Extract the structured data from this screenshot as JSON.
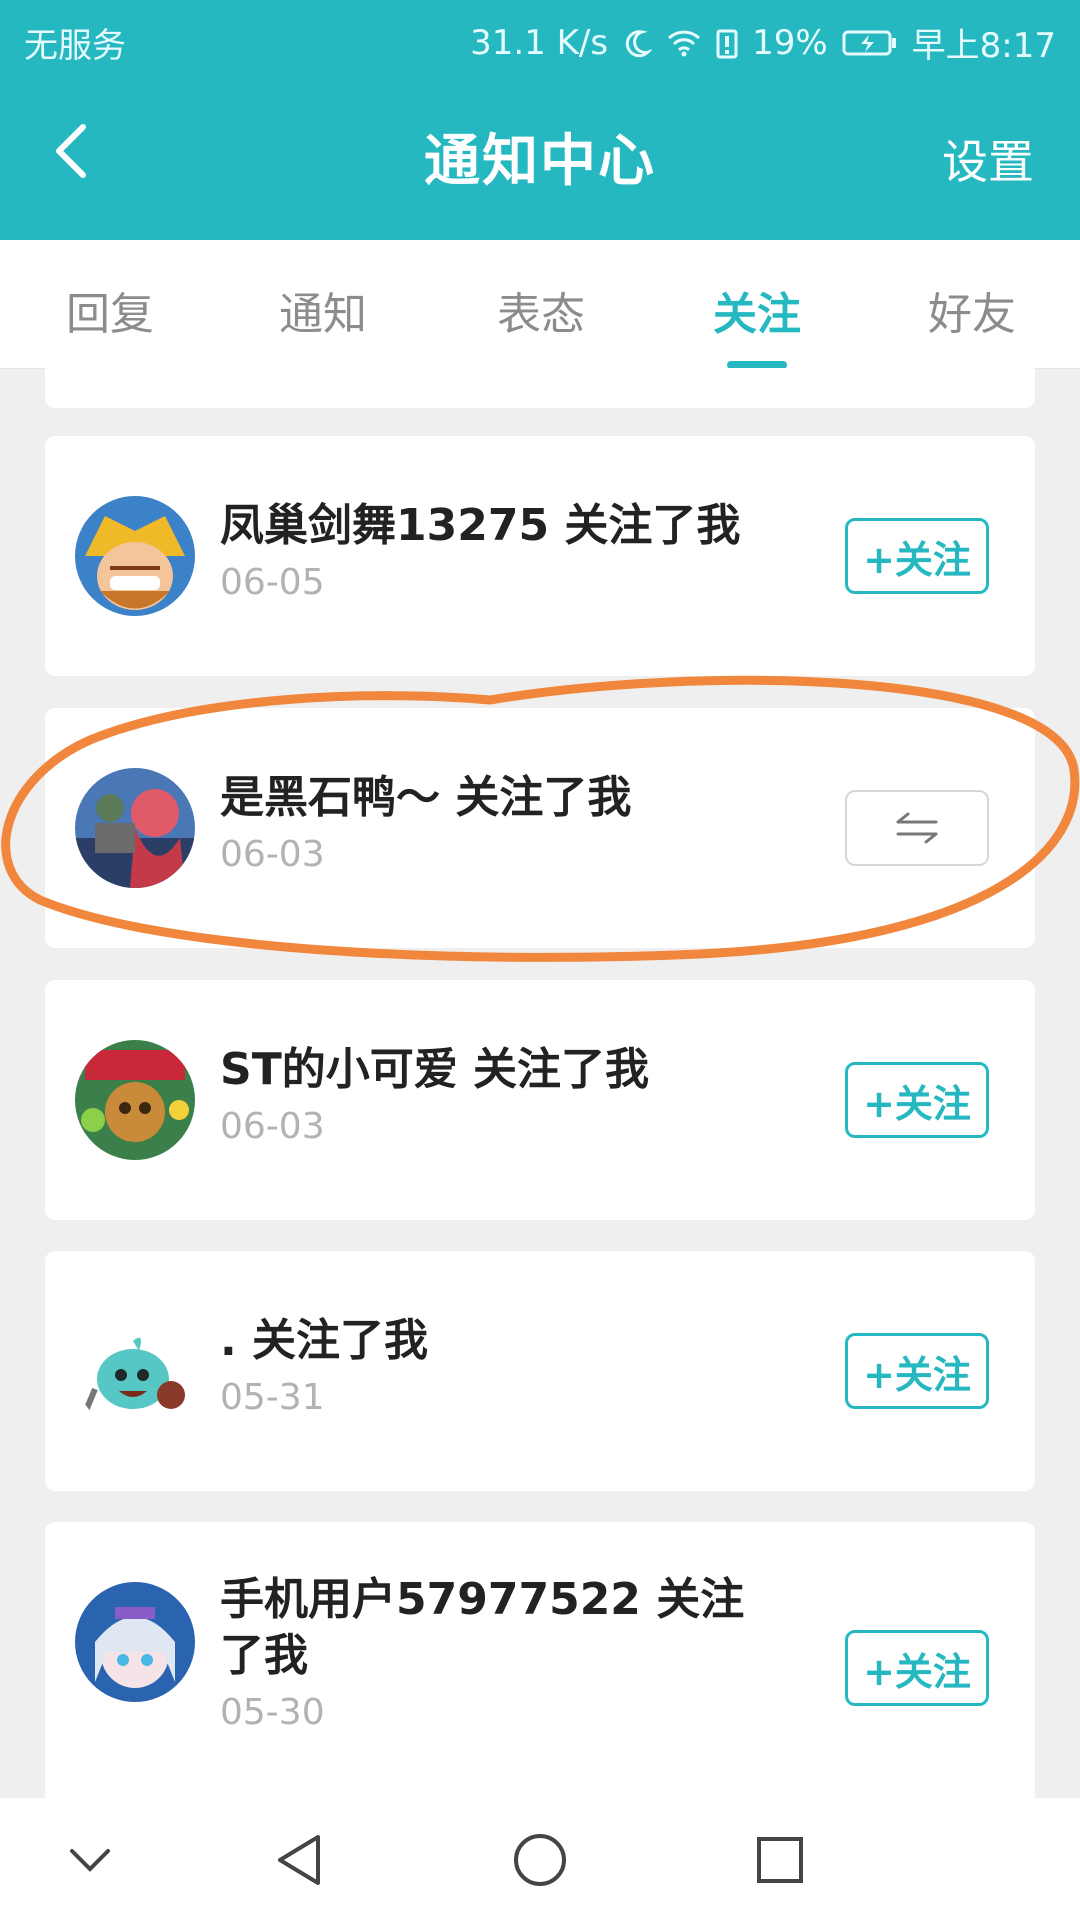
{
  "status_bar": {
    "carrier": "无服务",
    "speed": "31.1 K/s",
    "battery": "19%",
    "time": "早上8:17"
  },
  "header": {
    "title": "通知中心",
    "settings_label": "设置"
  },
  "tabs": [
    {
      "label": "回复",
      "active": false
    },
    {
      "label": "通知",
      "active": false
    },
    {
      "label": "表态",
      "active": false
    },
    {
      "label": "关注",
      "active": true
    },
    {
      "label": "好友",
      "active": false
    }
  ],
  "colors": {
    "accent": "#25b8c1",
    "highlight": "#f0873d"
  },
  "items": [
    {
      "title": "凤巢剑舞13275 关注了我",
      "date": "06-05",
      "button": "+关注",
      "mutual": false
    },
    {
      "title": "是黑石鸭～ 关注了我",
      "date": "06-03",
      "button": "",
      "mutual": true
    },
    {
      "title": "ST的小可爱 关注了我",
      "date": "06-03",
      "button": "+关注",
      "mutual": false
    },
    {
      "title": ". 关注了我",
      "date": "05-31",
      "button": "+关注",
      "mutual": false
    },
    {
      "title": "手机用户57977522 关注了我",
      "date": "05-30",
      "button": "+关注",
      "mutual": false
    }
  ]
}
